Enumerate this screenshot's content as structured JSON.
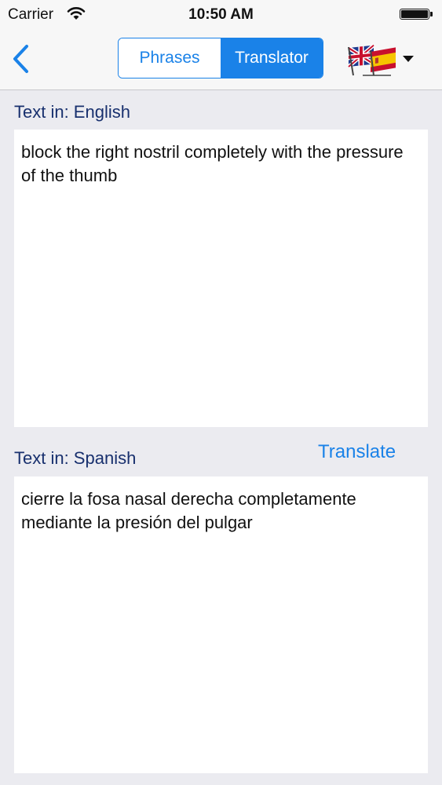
{
  "status_bar": {
    "carrier": "Carrier",
    "time": "10:50 AM",
    "icons": [
      "wifi-icon",
      "battery-icon"
    ]
  },
  "nav": {
    "back_icon": "chevron-left-icon",
    "segments": [
      {
        "label": "Phrases",
        "selected": false
      },
      {
        "label": "Translator",
        "selected": true
      }
    ],
    "language_picker_icon": "uk-spain-flags-icon",
    "accent_color": "#1a82e8"
  },
  "source": {
    "label": "Text in: English",
    "text": "block the right nostril completely with the pressure of the thumb"
  },
  "target": {
    "label": "Text in: Spanish",
    "text": "cierre la fosa nasal derecha completamente mediante la presión del pulgar"
  },
  "translate_label": "Translate"
}
